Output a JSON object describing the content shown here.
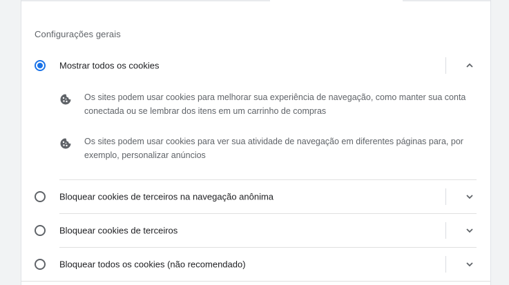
{
  "section_title": "Configurações gerais",
  "options": [
    {
      "label": "Mostrar todos os cookies",
      "selected": true,
      "expanded": true,
      "details": [
        {
          "icon": "cookie-icon",
          "text": "Os sites podem usar cookies para melhorar sua experiência de navegação, como manter sua conta conectada ou se lembrar dos itens em um carrinho de compras"
        },
        {
          "icon": "cookie-icon",
          "text": "Os sites podem usar cookies para ver sua atividade de navegação em diferentes páginas para, por exemplo, personalizar anúncios"
        }
      ]
    },
    {
      "label": "Bloquear cookies de terceiros na navegação anônima",
      "selected": false,
      "expanded": false
    },
    {
      "label": "Bloquear cookies de terceiros",
      "selected": false,
      "expanded": false
    },
    {
      "label": "Bloquear todos os cookies (não recomendado)",
      "selected": false,
      "expanded": false
    }
  ],
  "colors": {
    "accent": "#1a73e8",
    "text": "#202124",
    "secondary_text": "#5f6368"
  }
}
